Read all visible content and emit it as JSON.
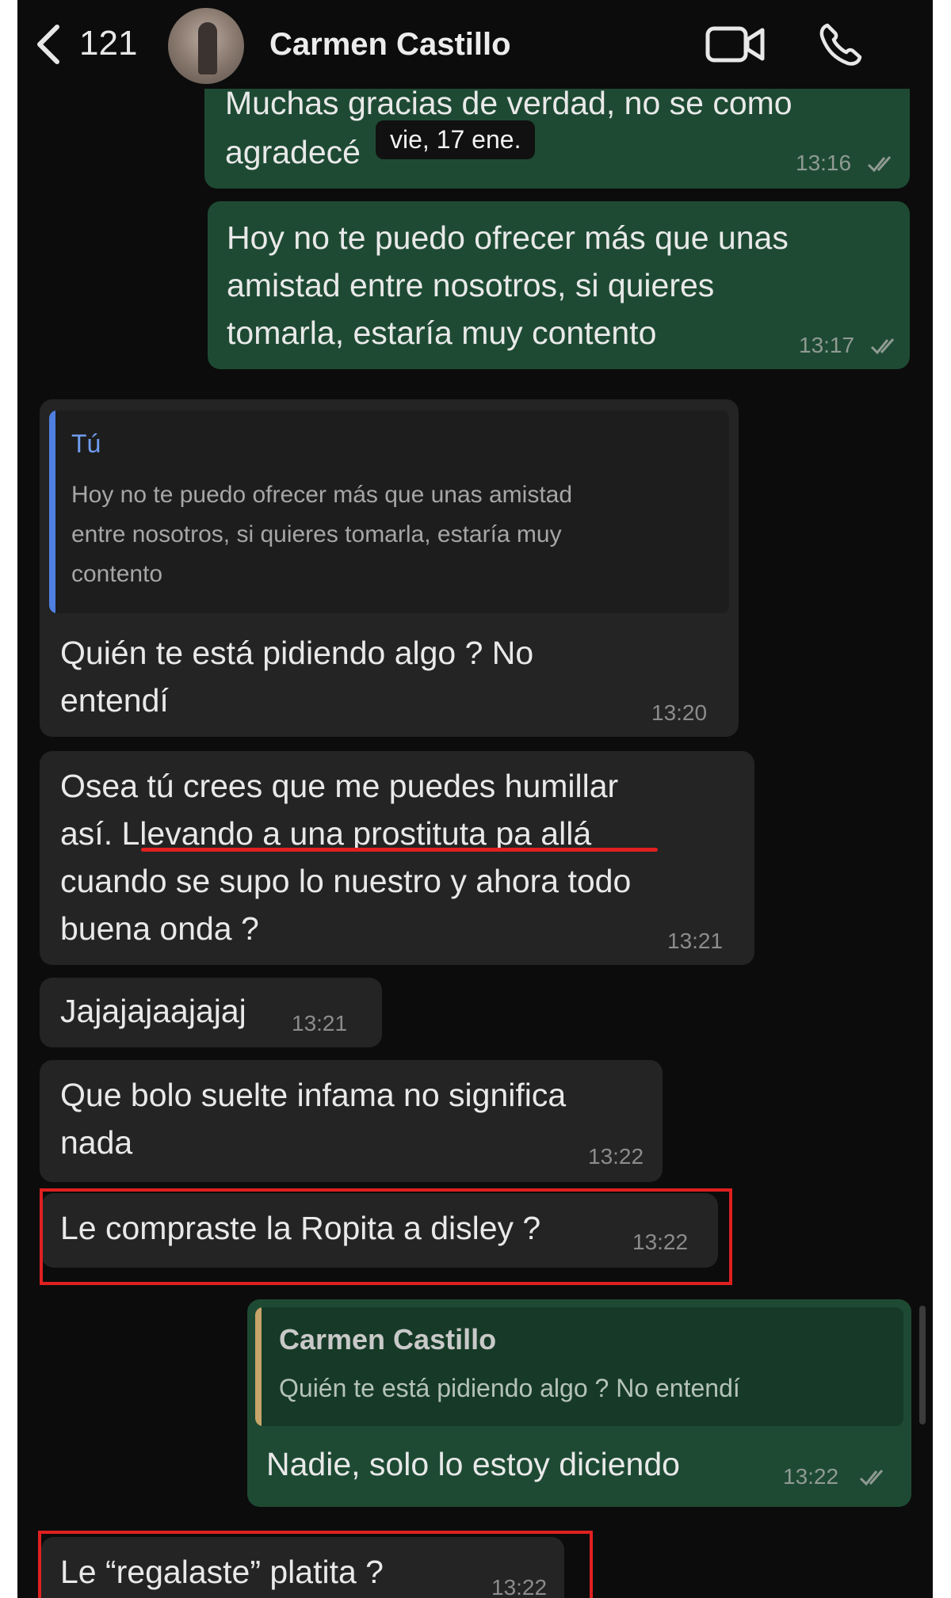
{
  "header": {
    "back_count": "121",
    "contact_name": "Carmen Castillo"
  },
  "date_pill": "vie, 17 ene.",
  "messages": [
    {
      "text1": "Muchas gracias de verdad, no se como",
      "text2": "agradecé",
      "time": "13:16"
    },
    {
      "text1": "Hoy no te puedo ofrecer más que unas",
      "text2": "amistad entre nosotros, si quieres",
      "text3": "tomarla, estaría muy contento",
      "time": "13:17"
    },
    {
      "quote_author": "Tú",
      "quote1": "Hoy no te puedo ofrecer más que unas amistad",
      "quote2": "entre nosotros, si quieres tomarla, estaría muy",
      "quote3": "contento",
      "text1": "Quién te está pidiendo algo ? No",
      "text2": "entendí",
      "time": "13:20"
    },
    {
      "text1": "Osea tú crees que me puedes humillar",
      "text2": "así. Llevando a una prostituta pa allá",
      "text3": "cuando se supo lo nuestro y ahora todo",
      "text4": "buena onda ?",
      "time": "13:21"
    },
    {
      "text1": "Jajajajaajajaj",
      "time": "13:21"
    },
    {
      "text1": "Que bolo suelte infama no significa",
      "text2": "nada",
      "time": "13:22"
    },
    {
      "text1": "Le compraste la Ropita a disley ?",
      "time": "13:22"
    },
    {
      "quote_author": "Carmen Castillo",
      "quote1": "Quién te está pidiendo algo ? No entendí",
      "text1": "Nadie, solo lo estoy diciendo",
      "time": "13:22"
    },
    {
      "text1": "Le  “regalaste” platita ?",
      "time": "13:22"
    }
  ],
  "colors": {
    "outgoing_bubble": "#1e4a33",
    "incoming_bubble": "#242424",
    "annotation_red": "#e02020",
    "quote_bar_you": "#4f7fe0",
    "quote_bar_contact": "#c8a56a"
  },
  "icons": [
    "chevron-left-icon",
    "video-camera-icon",
    "phone-icon",
    "double-check-icon"
  ]
}
